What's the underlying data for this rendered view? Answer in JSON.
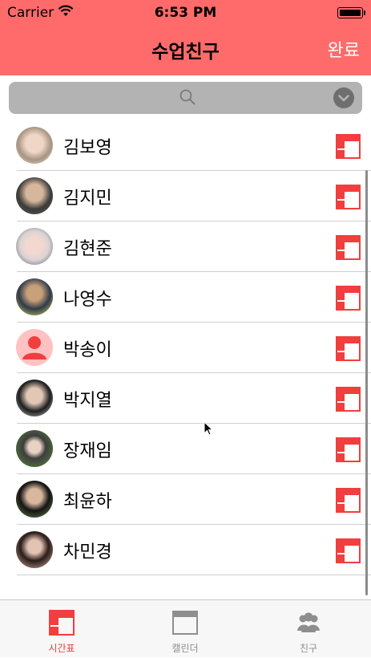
{
  "status_bar": {
    "carrier": "Carrier",
    "time": "6:53 PM"
  },
  "nav": {
    "title": "수업친구",
    "done_label": "완료"
  },
  "colors": {
    "accent": "#ff6b6b",
    "icon_red": "#f13e3e",
    "tab_inactive": "#8e8e8e"
  },
  "friends": [
    {
      "name": "김보영",
      "avatar": "photo"
    },
    {
      "name": "김지민",
      "avatar": "photo"
    },
    {
      "name": "김현준",
      "avatar": "photo"
    },
    {
      "name": "나영수",
      "avatar": "photo"
    },
    {
      "name": "박송이",
      "avatar": "default-person-icon"
    },
    {
      "name": "박지열",
      "avatar": "photo"
    },
    {
      "name": "장재임",
      "avatar": "photo"
    },
    {
      "name": "최윤하",
      "avatar": "photo"
    },
    {
      "name": "차민경",
      "avatar": "photo"
    }
  ],
  "tabbar": {
    "tabs": [
      {
        "label": "시간표",
        "icon": "timetable-icon",
        "selected": true
      },
      {
        "label": "캘린더",
        "icon": "calendar-icon",
        "selected": false
      },
      {
        "label": "친구",
        "icon": "friends-icon",
        "selected": false
      }
    ]
  }
}
